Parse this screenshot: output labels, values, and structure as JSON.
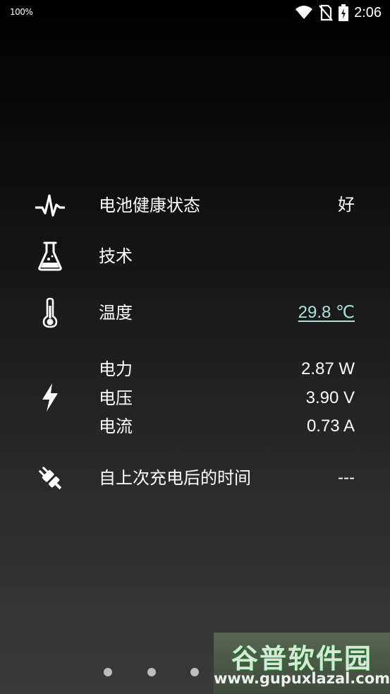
{
  "status_bar": {
    "battery_percent_text": "100%",
    "time": "2:06",
    "icons": [
      "wifi-icon",
      "no-sim-icon",
      "battery-charging-icon"
    ]
  },
  "rows": {
    "health": {
      "icon": "heartbeat-icon",
      "label": "电池健康状态",
      "value": "好"
    },
    "technology": {
      "icon": "flask-icon",
      "label": "技术",
      "value": ""
    },
    "temperature": {
      "icon": "thermometer-icon",
      "label": "温度",
      "value": "29.8 ℃"
    },
    "power": {
      "icon": "lightning-icon",
      "items": [
        {
          "label": "电力",
          "value": "2.87 W"
        },
        {
          "label": "电压",
          "value": "3.90 V"
        },
        {
          "label": "电流",
          "value": "0.73 A"
        }
      ]
    },
    "since_charge": {
      "icon": "plug-icon",
      "label": "自上次充电后的时间",
      "value": "---"
    }
  },
  "pager": {
    "page_count": 3
  },
  "watermark": {
    "title": "谷普软件园",
    "url": "www.gupuxlazal.com"
  },
  "colors": {
    "temperature_value": "#aee0da",
    "background_top": "#000000",
    "background_bottom": "#3a3a3a"
  }
}
